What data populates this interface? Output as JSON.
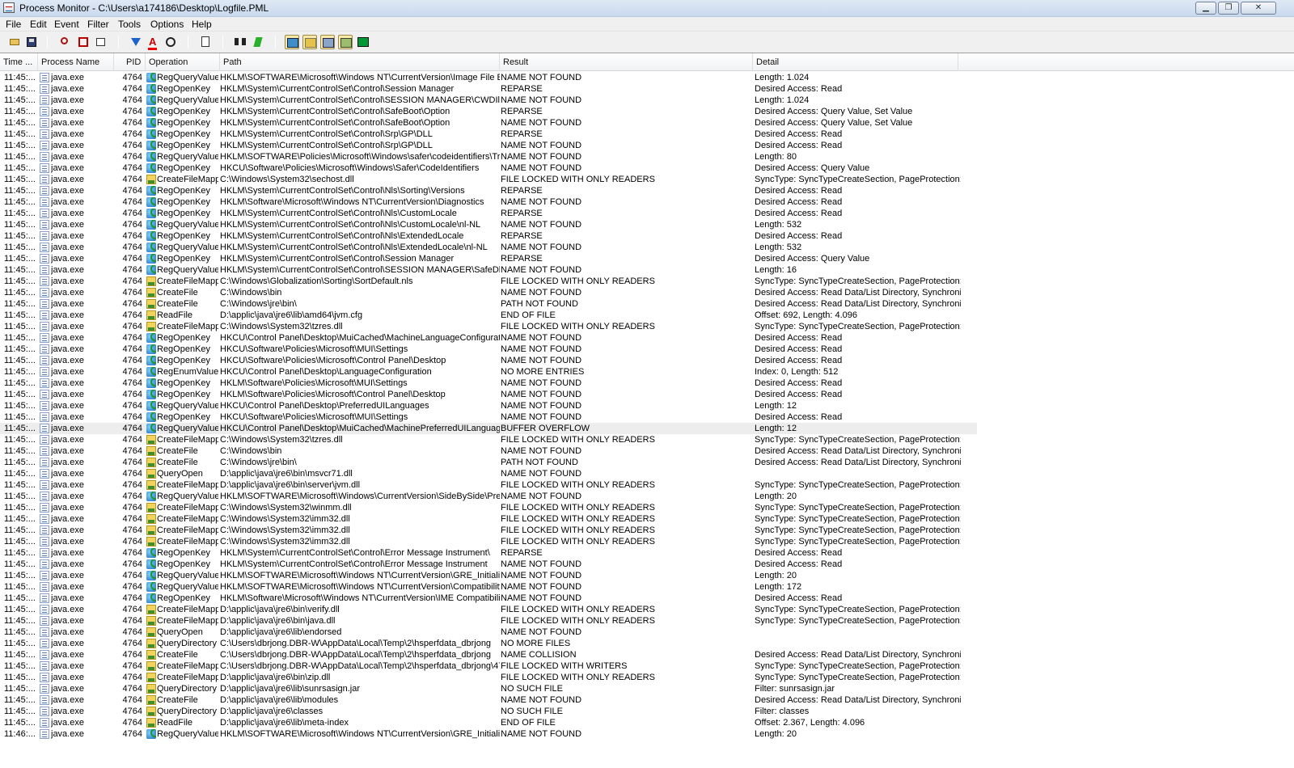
{
  "window": {
    "title": "Process Monitor - C:\\Users\\a174186\\Desktop\\Logfile.PML",
    "buttons": {
      "minimize": "▁",
      "maximize": "❐",
      "close": "✕"
    }
  },
  "menu": [
    "File",
    "Edit",
    "Event",
    "Filter",
    "Tools",
    "Options",
    "Help"
  ],
  "toolbar": {
    "buttons": [
      {
        "icon": "open-folder-icon",
        "active": false
      },
      {
        "icon": "save-icon",
        "active": false
      },
      {
        "icon": "magnify-capture-icon",
        "active": false
      },
      {
        "icon": "autoscroll-icon",
        "active": false
      },
      {
        "icon": "clear-display-icon",
        "active": false
      },
      {
        "icon": "filter-icon",
        "active": false
      },
      {
        "icon": "highlight-icon",
        "active": false
      },
      {
        "icon": "include-process-target-icon",
        "active": false
      },
      {
        "icon": "process-tree-icon",
        "active": false
      },
      {
        "icon": "find-icon",
        "active": false
      },
      {
        "icon": "jump-to-icon",
        "active": false
      },
      {
        "icon": "show-registry-icon",
        "active": true
      },
      {
        "icon": "show-filesystem-icon",
        "active": true
      },
      {
        "icon": "show-network-icon",
        "active": true
      },
      {
        "icon": "show-process-thread-icon",
        "active": true
      },
      {
        "icon": "show-profiling-icon",
        "active": false
      }
    ]
  },
  "columns": [
    "Time ...",
    "Process Name",
    "PID",
    "Operation",
    "Path",
    "Result",
    "Detail"
  ],
  "selected_row": 31,
  "rows": [
    {
      "time": "11:45:...",
      "process": "java.exe",
      "pid": "4764",
      "op_type": "reg",
      "operation": "RegQueryValue",
      "path": "HKLM\\SOFTWARE\\Microsoft\\Windows NT\\CurrentVersion\\Image File Exe...",
      "result": "NAME NOT FOUND",
      "detail": "Length: 1.024"
    },
    {
      "time": "11:45:...",
      "process": "java.exe",
      "pid": "4764",
      "op_type": "reg",
      "operation": "RegOpenKey",
      "path": "HKLM\\System\\CurrentControlSet\\Control\\Session Manager",
      "result": "REPARSE",
      "detail": "Desired Access: Read"
    },
    {
      "time": "11:45:...",
      "process": "java.exe",
      "pid": "4764",
      "op_type": "reg",
      "operation": "RegQueryValue",
      "path": "HKLM\\System\\CurrentControlSet\\Control\\SESSION MANAGER\\CWDIllegal...",
      "result": "NAME NOT FOUND",
      "detail": "Length: 1.024"
    },
    {
      "time": "11:45:...",
      "process": "java.exe",
      "pid": "4764",
      "op_type": "reg",
      "operation": "RegOpenKey",
      "path": "HKLM\\System\\CurrentControlSet\\Control\\SafeBoot\\Option",
      "result": "REPARSE",
      "detail": "Desired Access: Query Value, Set Value"
    },
    {
      "time": "11:45:...",
      "process": "java.exe",
      "pid": "4764",
      "op_type": "reg",
      "operation": "RegOpenKey",
      "path": "HKLM\\System\\CurrentControlSet\\Control\\SafeBoot\\Option",
      "result": "NAME NOT FOUND",
      "detail": "Desired Access: Query Value, Set Value"
    },
    {
      "time": "11:45:...",
      "process": "java.exe",
      "pid": "4764",
      "op_type": "reg",
      "operation": "RegOpenKey",
      "path": "HKLM\\System\\CurrentControlSet\\Control\\Srp\\GP\\DLL",
      "result": "REPARSE",
      "detail": "Desired Access: Read"
    },
    {
      "time": "11:45:...",
      "process": "java.exe",
      "pid": "4764",
      "op_type": "reg",
      "operation": "RegOpenKey",
      "path": "HKLM\\System\\CurrentControlSet\\Control\\Srp\\GP\\DLL",
      "result": "NAME NOT FOUND",
      "detail": "Desired Access: Read"
    },
    {
      "time": "11:45:...",
      "process": "java.exe",
      "pid": "4764",
      "op_type": "reg",
      "operation": "RegQueryValue",
      "path": "HKLM\\SOFTWARE\\Policies\\Microsoft\\Windows\\safer\\codeidentifiers\\Tran...",
      "result": "NAME NOT FOUND",
      "detail": "Length: 80"
    },
    {
      "time": "11:45:...",
      "process": "java.exe",
      "pid": "4764",
      "op_type": "reg",
      "operation": "RegOpenKey",
      "path": "HKCU\\Software\\Policies\\Microsoft\\Windows\\Safer\\CodeIdentifiers",
      "result": "NAME NOT FOUND",
      "detail": "Desired Access: Query Value"
    },
    {
      "time": "11:45:...",
      "process": "java.exe",
      "pid": "4764",
      "op_type": "file",
      "operation": "CreateFileMapp...",
      "path": "C:\\Windows\\System32\\sechost.dll",
      "result": "FILE LOCKED WITH ONLY READERS",
      "detail": "SyncType: SyncTypeCreateSection, PageProtection:"
    },
    {
      "time": "11:45:...",
      "process": "java.exe",
      "pid": "4764",
      "op_type": "reg",
      "operation": "RegOpenKey",
      "path": "HKLM\\System\\CurrentControlSet\\Control\\Nls\\Sorting\\Versions",
      "result": "REPARSE",
      "detail": "Desired Access: Read"
    },
    {
      "time": "11:45:...",
      "process": "java.exe",
      "pid": "4764",
      "op_type": "reg",
      "operation": "RegOpenKey",
      "path": "HKLM\\Software\\Microsoft\\Windows NT\\CurrentVersion\\Diagnostics",
      "result": "NAME NOT FOUND",
      "detail": "Desired Access: Read"
    },
    {
      "time": "11:45:...",
      "process": "java.exe",
      "pid": "4764",
      "op_type": "reg",
      "operation": "RegOpenKey",
      "path": "HKLM\\System\\CurrentControlSet\\Control\\Nls\\CustomLocale",
      "result": "REPARSE",
      "detail": "Desired Access: Read"
    },
    {
      "time": "11:45:...",
      "process": "java.exe",
      "pid": "4764",
      "op_type": "reg",
      "operation": "RegQueryValue",
      "path": "HKLM\\System\\CurrentControlSet\\Control\\Nls\\CustomLocale\\nl-NL",
      "result": "NAME NOT FOUND",
      "detail": "Length: 532"
    },
    {
      "time": "11:45:...",
      "process": "java.exe",
      "pid": "4764",
      "op_type": "reg",
      "operation": "RegOpenKey",
      "path": "HKLM\\System\\CurrentControlSet\\Control\\Nls\\ExtendedLocale",
      "result": "REPARSE",
      "detail": "Desired Access: Read"
    },
    {
      "time": "11:45:...",
      "process": "java.exe",
      "pid": "4764",
      "op_type": "reg",
      "operation": "RegQueryValue",
      "path": "HKLM\\System\\CurrentControlSet\\Control\\Nls\\ExtendedLocale\\nl-NL",
      "result": "NAME NOT FOUND",
      "detail": "Length: 532"
    },
    {
      "time": "11:45:...",
      "process": "java.exe",
      "pid": "4764",
      "op_type": "reg",
      "operation": "RegOpenKey",
      "path": "HKLM\\System\\CurrentControlSet\\Control\\Session Manager",
      "result": "REPARSE",
      "detail": "Desired Access: Query Value"
    },
    {
      "time": "11:45:...",
      "process": "java.exe",
      "pid": "4764",
      "op_type": "reg",
      "operation": "RegQueryValue",
      "path": "HKLM\\System\\CurrentControlSet\\Control\\SESSION MANAGER\\SafeDllSea...",
      "result": "NAME NOT FOUND",
      "detail": "Length: 16"
    },
    {
      "time": "11:45:...",
      "process": "java.exe",
      "pid": "4764",
      "op_type": "file",
      "operation": "CreateFileMapp...",
      "path": "C:\\Windows\\Globalization\\Sorting\\SortDefault.nls",
      "result": "FILE LOCKED WITH ONLY READERS",
      "detail": "SyncType: SyncTypeCreateSection, PageProtection:"
    },
    {
      "time": "11:45:...",
      "process": "java.exe",
      "pid": "4764",
      "op_type": "file",
      "operation": "CreateFile",
      "path": "C:\\Windows\\bin",
      "result": "NAME NOT FOUND",
      "detail": "Desired Access: Read Data/List Directory, Synchroniz..."
    },
    {
      "time": "11:45:...",
      "process": "java.exe",
      "pid": "4764",
      "op_type": "file",
      "operation": "CreateFile",
      "path": "C:\\Windows\\jre\\bin\\",
      "result": "PATH NOT FOUND",
      "detail": "Desired Access: Read Data/List Directory, Synchroniz..."
    },
    {
      "time": "11:45:...",
      "process": "java.exe",
      "pid": "4764",
      "op_type": "file",
      "operation": "ReadFile",
      "path": "D:\\applic\\java\\jre6\\lib\\amd64\\jvm.cfg",
      "result": "END OF FILE",
      "detail": "Offset: 692, Length: 4.096"
    },
    {
      "time": "11:45:...",
      "process": "java.exe",
      "pid": "4764",
      "op_type": "file",
      "operation": "CreateFileMapp...",
      "path": "C:\\Windows\\System32\\tzres.dll",
      "result": "FILE LOCKED WITH ONLY READERS",
      "detail": "SyncType: SyncTypeCreateSection, PageProtection:"
    },
    {
      "time": "11:45:...",
      "process": "java.exe",
      "pid": "4764",
      "op_type": "reg",
      "operation": "RegOpenKey",
      "path": "HKCU\\Control Panel\\Desktop\\MuiCached\\MachineLanguageConfiguration",
      "result": "NAME NOT FOUND",
      "detail": "Desired Access: Read"
    },
    {
      "time": "11:45:...",
      "process": "java.exe",
      "pid": "4764",
      "op_type": "reg",
      "operation": "RegOpenKey",
      "path": "HKCU\\Software\\Policies\\Microsoft\\MUI\\Settings",
      "result": "NAME NOT FOUND",
      "detail": "Desired Access: Read"
    },
    {
      "time": "11:45:...",
      "process": "java.exe",
      "pid": "4764",
      "op_type": "reg",
      "operation": "RegOpenKey",
      "path": "HKCU\\Software\\Policies\\Microsoft\\Control Panel\\Desktop",
      "result": "NAME NOT FOUND",
      "detail": "Desired Access: Read"
    },
    {
      "time": "11:45:...",
      "process": "java.exe",
      "pid": "4764",
      "op_type": "reg",
      "operation": "RegEnumValue",
      "path": "HKCU\\Control Panel\\Desktop\\LanguageConfiguration",
      "result": "NO MORE ENTRIES",
      "detail": "Index: 0, Length: 512"
    },
    {
      "time": "11:45:...",
      "process": "java.exe",
      "pid": "4764",
      "op_type": "reg",
      "operation": "RegOpenKey",
      "path": "HKLM\\Software\\Policies\\Microsoft\\MUI\\Settings",
      "result": "NAME NOT FOUND",
      "detail": "Desired Access: Read"
    },
    {
      "time": "11:45:...",
      "process": "java.exe",
      "pid": "4764",
      "op_type": "reg",
      "operation": "RegOpenKey",
      "path": "HKLM\\Software\\Policies\\Microsoft\\Control Panel\\Desktop",
      "result": "NAME NOT FOUND",
      "detail": "Desired Access: Read"
    },
    {
      "time": "11:45:...",
      "process": "java.exe",
      "pid": "4764",
      "op_type": "reg",
      "operation": "RegQueryValue",
      "path": "HKCU\\Control Panel\\Desktop\\PreferredUILanguages",
      "result": "NAME NOT FOUND",
      "detail": "Length: 12"
    },
    {
      "time": "11:45:...",
      "process": "java.exe",
      "pid": "4764",
      "op_type": "reg",
      "operation": "RegOpenKey",
      "path": "HKCU\\Software\\Policies\\Microsoft\\MUI\\Settings",
      "result": "NAME NOT FOUND",
      "detail": "Desired Access: Read"
    },
    {
      "time": "11:45:...",
      "process": "java.exe",
      "pid": "4764",
      "op_type": "reg",
      "operation": "RegQueryValue",
      "path": "HKCU\\Control Panel\\Desktop\\MuiCached\\MachinePreferredUILanguages",
      "result": "BUFFER OVERFLOW",
      "detail": "Length: 12"
    },
    {
      "time": "11:45:...",
      "process": "java.exe",
      "pid": "4764",
      "op_type": "file",
      "operation": "CreateFileMapp...",
      "path": "C:\\Windows\\System32\\tzres.dll",
      "result": "FILE LOCKED WITH ONLY READERS",
      "detail": "SyncType: SyncTypeCreateSection, PageProtection:"
    },
    {
      "time": "11:45:...",
      "process": "java.exe",
      "pid": "4764",
      "op_type": "file",
      "operation": "CreateFile",
      "path": "C:\\Windows\\bin",
      "result": "NAME NOT FOUND",
      "detail": "Desired Access: Read Data/List Directory, Synchroniz..."
    },
    {
      "time": "11:45:...",
      "process": "java.exe",
      "pid": "4764",
      "op_type": "file",
      "operation": "CreateFile",
      "path": "C:\\Windows\\jre\\bin\\",
      "result": "PATH NOT FOUND",
      "detail": "Desired Access: Read Data/List Directory, Synchroniz..."
    },
    {
      "time": "11:45:...",
      "process": "java.exe",
      "pid": "4764",
      "op_type": "file",
      "operation": "QueryOpen",
      "path": "D:\\applic\\java\\jre6\\bin\\msvcr71.dll",
      "result": "NAME NOT FOUND",
      "detail": ""
    },
    {
      "time": "11:45:...",
      "process": "java.exe",
      "pid": "4764",
      "op_type": "file",
      "operation": "CreateFileMapp...",
      "path": "D:\\applic\\java\\jre6\\bin\\server\\jvm.dll",
      "result": "FILE LOCKED WITH ONLY READERS",
      "detail": "SyncType: SyncTypeCreateSection, PageProtection:"
    },
    {
      "time": "11:45:...",
      "process": "java.exe",
      "pid": "4764",
      "op_type": "reg",
      "operation": "RegQueryValue",
      "path": "HKLM\\SOFTWARE\\Microsoft\\Windows\\CurrentVersion\\SideBySide\\Prefer...",
      "result": "NAME NOT FOUND",
      "detail": "Length: 20"
    },
    {
      "time": "11:45:...",
      "process": "java.exe",
      "pid": "4764",
      "op_type": "file",
      "operation": "CreateFileMapp...",
      "path": "C:\\Windows\\System32\\winmm.dll",
      "result": "FILE LOCKED WITH ONLY READERS",
      "detail": "SyncType: SyncTypeCreateSection, PageProtection:"
    },
    {
      "time": "11:45:...",
      "process": "java.exe",
      "pid": "4764",
      "op_type": "file",
      "operation": "CreateFileMapp...",
      "path": "C:\\Windows\\System32\\imm32.dll",
      "result": "FILE LOCKED WITH ONLY READERS",
      "detail": "SyncType: SyncTypeCreateSection, PageProtection:"
    },
    {
      "time": "11:45:...",
      "process": "java.exe",
      "pid": "4764",
      "op_type": "file",
      "operation": "CreateFileMapp...",
      "path": "C:\\Windows\\System32\\imm32.dll",
      "result": "FILE LOCKED WITH ONLY READERS",
      "detail": "SyncType: SyncTypeCreateSection, PageProtection:"
    },
    {
      "time": "11:45:...",
      "process": "java.exe",
      "pid": "4764",
      "op_type": "file",
      "operation": "CreateFileMapp...",
      "path": "C:\\Windows\\System32\\imm32.dll",
      "result": "FILE LOCKED WITH ONLY READERS",
      "detail": "SyncType: SyncTypeCreateSection, PageProtection:"
    },
    {
      "time": "11:45:...",
      "process": "java.exe",
      "pid": "4764",
      "op_type": "reg",
      "operation": "RegOpenKey",
      "path": "HKLM\\System\\CurrentControlSet\\Control\\Error Message Instrument\\",
      "result": "REPARSE",
      "detail": "Desired Access: Read"
    },
    {
      "time": "11:45:...",
      "process": "java.exe",
      "pid": "4764",
      "op_type": "reg",
      "operation": "RegOpenKey",
      "path": "HKLM\\System\\CurrentControlSet\\Control\\Error Message Instrument",
      "result": "NAME NOT FOUND",
      "detail": "Desired Access: Read"
    },
    {
      "time": "11:45:...",
      "process": "java.exe",
      "pid": "4764",
      "op_type": "reg",
      "operation": "RegQueryValue",
      "path": "HKLM\\SOFTWARE\\Microsoft\\Windows NT\\CurrentVersion\\GRE_Initialize\\...",
      "result": "NAME NOT FOUND",
      "detail": "Length: 20"
    },
    {
      "time": "11:45:...",
      "process": "java.exe",
      "pid": "4764",
      "op_type": "reg",
      "operation": "RegQueryValue",
      "path": "HKLM\\SOFTWARE\\Microsoft\\Windows NT\\CurrentVersion\\Compatibility32...",
      "result": "NAME NOT FOUND",
      "detail": "Length: 172"
    },
    {
      "time": "11:45:...",
      "process": "java.exe",
      "pid": "4764",
      "op_type": "reg",
      "operation": "RegOpenKey",
      "path": "HKLM\\Software\\Microsoft\\Windows NT\\CurrentVersion\\IME Compatibility",
      "result": "NAME NOT FOUND",
      "detail": "Desired Access: Read"
    },
    {
      "time": "11:45:...",
      "process": "java.exe",
      "pid": "4764",
      "op_type": "file",
      "operation": "CreateFileMapp...",
      "path": "D:\\applic\\java\\jre6\\bin\\verify.dll",
      "result": "FILE LOCKED WITH ONLY READERS",
      "detail": "SyncType: SyncTypeCreateSection, PageProtection:"
    },
    {
      "time": "11:45:...",
      "process": "java.exe",
      "pid": "4764",
      "op_type": "file",
      "operation": "CreateFileMapp...",
      "path": "D:\\applic\\java\\jre6\\bin\\java.dll",
      "result": "FILE LOCKED WITH ONLY READERS",
      "detail": "SyncType: SyncTypeCreateSection, PageProtection:"
    },
    {
      "time": "11:45:...",
      "process": "java.exe",
      "pid": "4764",
      "op_type": "file",
      "operation": "QueryOpen",
      "path": "D:\\applic\\java\\jre6\\lib\\endorsed",
      "result": "NAME NOT FOUND",
      "detail": ""
    },
    {
      "time": "11:45:...",
      "process": "java.exe",
      "pid": "4764",
      "op_type": "file",
      "operation": "QueryDirectory",
      "path": "C:\\Users\\dbrjong.DBR-W\\AppData\\Local\\Temp\\2\\hsperfdata_dbrjong",
      "result": "NO MORE FILES",
      "detail": ""
    },
    {
      "time": "11:45:...",
      "process": "java.exe",
      "pid": "4764",
      "op_type": "file",
      "operation": "CreateFile",
      "path": "C:\\Users\\dbrjong.DBR-W\\AppData\\Local\\Temp\\2\\hsperfdata_dbrjong",
      "result": "NAME COLLISION",
      "detail": "Desired Access: Read Data/List Directory, Synchroniz..."
    },
    {
      "time": "11:45:...",
      "process": "java.exe",
      "pid": "4764",
      "op_type": "file",
      "operation": "CreateFileMapp...",
      "path": "C:\\Users\\dbrjong.DBR-W\\AppData\\Local\\Temp\\2\\hsperfdata_dbrjong\\4764",
      "result": "FILE LOCKED WITH WRITERS",
      "detail": "SyncType: SyncTypeCreateSection, PageProtection:"
    },
    {
      "time": "11:45:...",
      "process": "java.exe",
      "pid": "4764",
      "op_type": "file",
      "operation": "CreateFileMapp...",
      "path": "D:\\applic\\java\\jre6\\bin\\zip.dll",
      "result": "FILE LOCKED WITH ONLY READERS",
      "detail": "SyncType: SyncTypeCreateSection, PageProtection:"
    },
    {
      "time": "11:45:...",
      "process": "java.exe",
      "pid": "4764",
      "op_type": "file",
      "operation": "QueryDirectory",
      "path": "D:\\applic\\java\\jre6\\lib\\sunrsasign.jar",
      "result": "NO SUCH FILE",
      "detail": "Filter: sunrsasign.jar"
    },
    {
      "time": "11:45:...",
      "process": "java.exe",
      "pid": "4764",
      "op_type": "file",
      "operation": "CreateFile",
      "path": "D:\\applic\\java\\jre6\\lib\\modules",
      "result": "NAME NOT FOUND",
      "detail": "Desired Access: Read Data/List Directory, Synchroniz..."
    },
    {
      "time": "11:45:...",
      "process": "java.exe",
      "pid": "4764",
      "op_type": "file",
      "operation": "QueryDirectory",
      "path": "D:\\applic\\java\\jre6\\classes",
      "result": "NO SUCH FILE",
      "detail": "Filter: classes"
    },
    {
      "time": "11:45:...",
      "process": "java.exe",
      "pid": "4764",
      "op_type": "file",
      "operation": "ReadFile",
      "path": "D:\\applic\\java\\jre6\\lib\\meta-index",
      "result": "END OF FILE",
      "detail": "Offset: 2.367, Length: 4.096"
    },
    {
      "time": "11:46:...",
      "process": "java.exe",
      "pid": "4764",
      "op_type": "reg",
      "operation": "RegQueryValue",
      "path": "HKLM\\SOFTWARE\\Microsoft\\Windows NT\\CurrentVersion\\GRE_Initialize\\...",
      "result": "NAME NOT FOUND",
      "detail": "Length: 20"
    }
  ]
}
